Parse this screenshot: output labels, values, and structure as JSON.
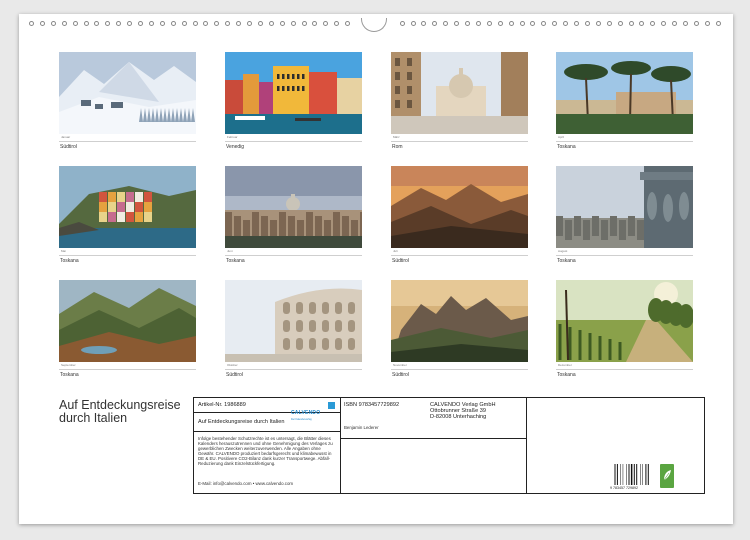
{
  "calendar": {
    "title_line1": "Auf Entdeckungsreise",
    "title_line2": "durch Italien",
    "months": [
      {
        "month": "Januar",
        "caption": "Südtirol",
        "scene": "snow"
      },
      {
        "month": "Februar",
        "caption": "Venedig",
        "scene": "venice"
      },
      {
        "month": "März",
        "caption": "Rom",
        "scene": "rome"
      },
      {
        "month": "April",
        "caption": "Toskana",
        "scene": "pines"
      },
      {
        "month": "Mai",
        "caption": "Toskana",
        "scene": "cinqueterre"
      },
      {
        "month": "Juni",
        "caption": "Toskana",
        "scene": "skyline"
      },
      {
        "month": "Juli",
        "caption": "Südtirol",
        "scene": "sunset-mountains"
      },
      {
        "month": "August",
        "caption": "Toskana",
        "scene": "statues"
      },
      {
        "month": "September",
        "caption": "Toskana",
        "scene": "green-mountains"
      },
      {
        "month": "Oktober",
        "caption": "Südtirol",
        "scene": "colosseum"
      },
      {
        "month": "November",
        "caption": "Südtirol",
        "scene": "dolomites"
      },
      {
        "month": "Dezember",
        "caption": "Toskana",
        "scene": "vineyard"
      }
    ]
  },
  "info": {
    "article_label": "Artikel-Nr. 1986889",
    "logo_text": "CALVENDO",
    "logo_sub": "Der Kalenderverlag",
    "product_title": "Auf Entdeckungsreise durch Italien",
    "legal_text": "Infolge bestehender Schutzrechte ist es untersagt, die Blätter dieses Kalenders herauszutrennen und ohne Genehmigung des Verlages zu gewerblichen Zwecken weiterzuverwenden. Alle Angaben ohne Gewähr. CALVENDO produziert bedarfsgerecht und klimabewusst in DE & EU. Positivere CO2-Bilanz dank kurzer Transportwege. Abfall-Reduzierung dank Einzelstückfertigung.",
    "email": "E-Mail: info@calvendo.com • www.calvendo.com",
    "isbn": "ISBN 9783457729892",
    "author": "Benjamin Lederer",
    "publisher_line1": "CALVENDO Verlag GmbH",
    "publisher_line2": "Ottobrunner Straße 39",
    "publisher_line3": "D-82008 Unterhaching",
    "barcode_number": "9 783457 729892"
  },
  "colors": {
    "sheet": "#ffffff",
    "background": "#e9e9e9",
    "logo_blue": "#1f86c9",
    "recycle_green": "#5aa541"
  }
}
